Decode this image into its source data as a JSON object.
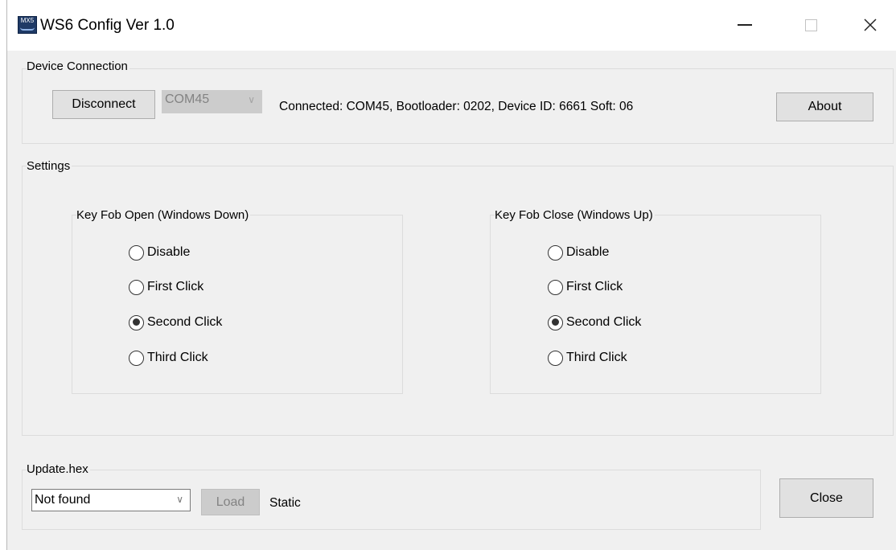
{
  "window": {
    "title": "WS6 Config Ver 1.0",
    "app_icon_text": "MX5"
  },
  "device_connection": {
    "group_label": "Device Connection",
    "disconnect_label": "Disconnect",
    "port_value": "COM45",
    "status_text": "Connected: COM45, Bootloader: 0202, Device ID: 6661 Soft: 06",
    "about_label": "About"
  },
  "settings": {
    "group_label": "Settings",
    "open_group": {
      "label": "Key Fob Open (Windows Down)",
      "options": [
        {
          "label": "Disable",
          "checked": false
        },
        {
          "label": "First Click",
          "checked": false
        },
        {
          "label": "Second Click",
          "checked": true
        },
        {
          "label": "Third Click",
          "checked": false
        }
      ]
    },
    "close_group": {
      "label": "Key Fob Close (Windows Up)",
      "options": [
        {
          "label": "Disable",
          "checked": false
        },
        {
          "label": "First Click",
          "checked": false
        },
        {
          "label": "Second Click",
          "checked": true
        },
        {
          "label": "Third Click",
          "checked": false
        }
      ]
    }
  },
  "update": {
    "group_label": "Update.hex",
    "file_value": "Not found",
    "load_label": "Load",
    "status_text": "Static"
  },
  "close_label": "Close",
  "colors": {
    "window_bg": "#f0f0f0",
    "titlebar_bg": "#ffffff",
    "button_bg": "#e1e1e1",
    "disabled_bg": "#cccccc"
  }
}
